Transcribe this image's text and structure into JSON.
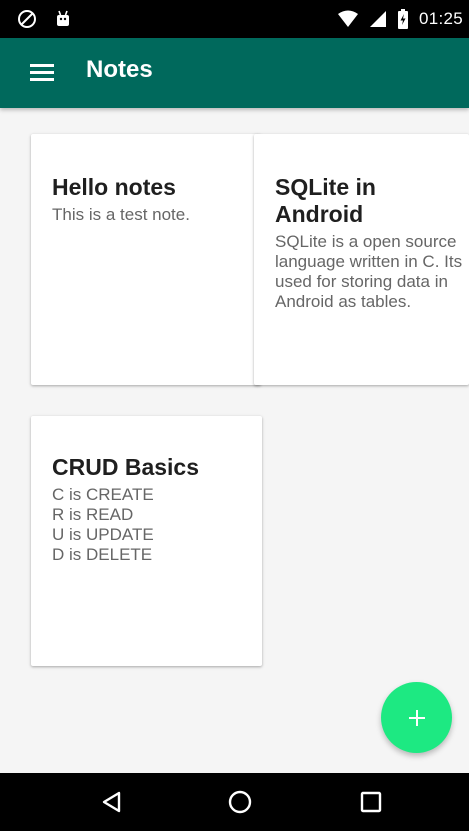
{
  "status_bar": {
    "time": "01:25",
    "left_icons": [
      "no-sim-icon",
      "android-debug-icon"
    ],
    "right_icons": [
      "wifi-icon",
      "cell-signal-icon",
      "battery-charging-icon"
    ]
  },
  "app_bar": {
    "menu_icon": "hamburger-menu-icon",
    "title": "Notes",
    "color": "#00695c"
  },
  "notes": [
    {
      "title": "Hello notes",
      "body": "This is a test note."
    },
    {
      "title": "SQLite in Android",
      "body": "SQLite is a open source language written in C. Its used for storing data in Android as tables."
    },
    {
      "title": "CRUD Basics",
      "body": "C  is CREATE\nR is READ\nU is UPDATE\nD is DELETE"
    }
  ],
  "fab": {
    "icon": "plus-icon",
    "color": "#1de982"
  },
  "nav_bar": {
    "buttons": [
      "back-icon",
      "home-icon",
      "recents-icon"
    ]
  }
}
